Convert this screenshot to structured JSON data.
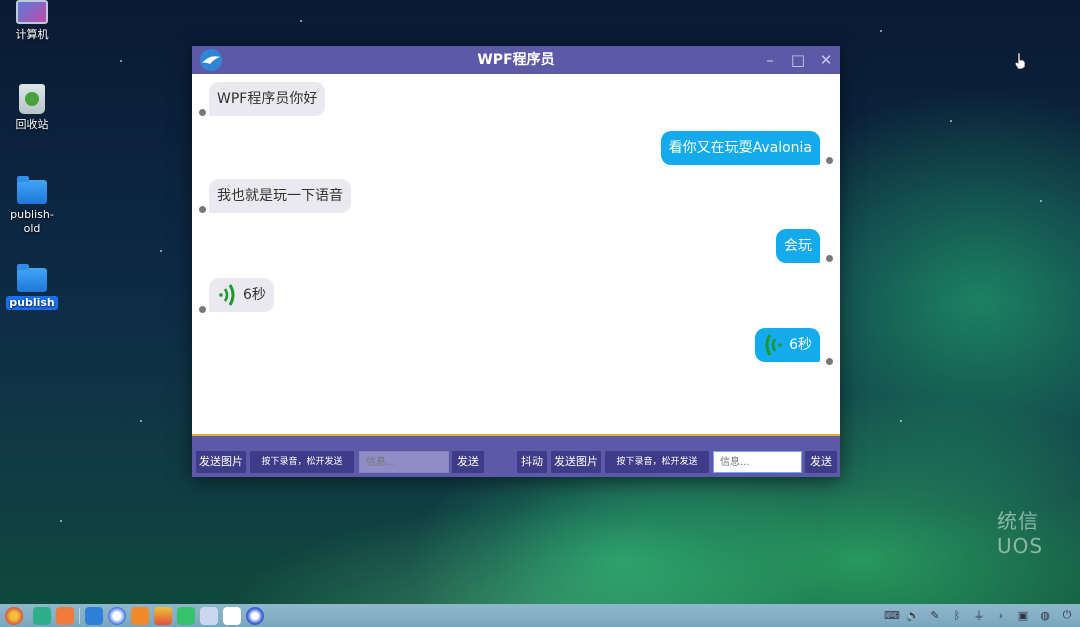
{
  "desktop": {
    "icons": [
      {
        "label": "计算机"
      },
      {
        "label": "回收站"
      },
      {
        "label": "publish-old"
      },
      {
        "label": "publish"
      }
    ],
    "watermark": "统信UOS"
  },
  "window": {
    "title": "WPF程序员",
    "controls": {
      "minimize": "–",
      "maximize": "□",
      "close": "✕"
    }
  },
  "messages": [
    {
      "side": "left",
      "text": "WPF程序员你好"
    },
    {
      "side": "right",
      "text": "看你又在玩耍Avalonia"
    },
    {
      "side": "left",
      "text": "我也就是玩一下语音"
    },
    {
      "side": "right",
      "text": "会玩"
    },
    {
      "side": "left",
      "voice": true,
      "text": "6秒"
    },
    {
      "side": "right",
      "voice": true,
      "text": "6秒"
    }
  ],
  "toolbar": {
    "left": {
      "send_image": "发送图片",
      "record": "按下录音，松开发送",
      "input_placeholder": "信息...",
      "send": "发送"
    },
    "right": {
      "shake": "抖动",
      "send_image": "发送图片",
      "record": "按下录音，松开发送",
      "input_placeholder": "信息...",
      "send": "发送"
    }
  },
  "colors": {
    "titlebar": "#5c5aa6",
    "bubble_right": "#14abec",
    "bubble_left": "#e9e9ef",
    "voice_icon": "#1a9a2a"
  }
}
